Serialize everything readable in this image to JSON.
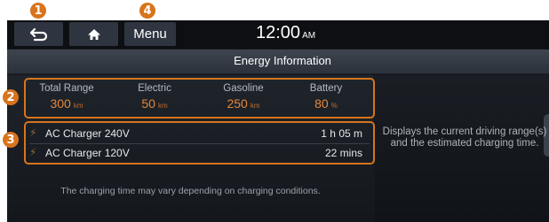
{
  "callouts": {
    "c1": "1",
    "c2": "2",
    "c3": "3",
    "c4": "4"
  },
  "topbar": {
    "back_icon": "back-arrow-icon",
    "home_icon": "home-icon",
    "menu_label": "Menu",
    "clock_time": "12:00",
    "clock_ampm": "AM"
  },
  "title": "Energy Information",
  "range": {
    "columns": [
      {
        "label": "Total Range",
        "value": "300",
        "unit": "km"
      },
      {
        "label": "Electric",
        "value": "50",
        "unit": "km"
      },
      {
        "label": "Gasoline",
        "value": "250",
        "unit": "km"
      },
      {
        "label": "Battery",
        "value": "80",
        "unit": "%"
      }
    ]
  },
  "charging": {
    "rows": [
      {
        "icon": "lightning-icon",
        "name": "AC Charger 240V",
        "time": "1 h  05 m"
      },
      {
        "icon": "lightning-icon",
        "name": "AC Charger 120V",
        "time": "22 mins"
      }
    ]
  },
  "note": "The charging time may vary depending on charging conditions.",
  "description": "Displays the current driving range(s) and the estimated charging time.",
  "colors": {
    "accent": "#d8741c",
    "value_orange": "#e4873a",
    "screen_bg": "#15181d"
  }
}
